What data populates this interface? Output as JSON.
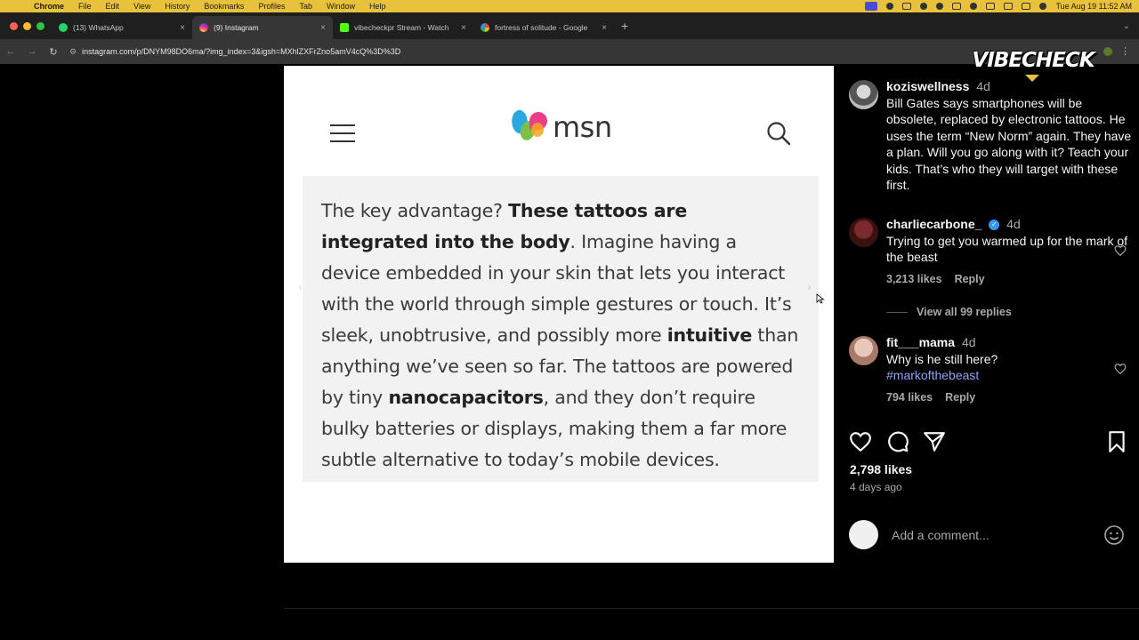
{
  "menubar": {
    "app_name": "Chrome",
    "items": [
      "File",
      "Edit",
      "View",
      "History",
      "Bookmarks",
      "Profiles",
      "Tab",
      "Window",
      "Help"
    ],
    "clock": "Tue Aug 19  11:52 AM"
  },
  "tabs": [
    {
      "title": "(13) WhatsApp",
      "icon": "whatsapp-icon",
      "active": false
    },
    {
      "title": "(9) Instagram",
      "icon": "instagram-icon",
      "active": true
    },
    {
      "title": "vibecheckpr Stream - Watch",
      "icon": "kick-icon",
      "active": false
    },
    {
      "title": "fortress of solitude - Google",
      "icon": "google-icon",
      "active": false
    }
  ],
  "addressbar": {
    "url": "instagram.com/p/DNYM98DO6ma/?img_index=3&igsh=MXhlZXFrZno5amV4cQ%3D%3D"
  },
  "overlay": {
    "logo_text": "VIBECHECK"
  },
  "post": {
    "msn_logo_text": "msn",
    "article": {
      "segments": [
        {
          "text": "The key advantage? ",
          "bold": false
        },
        {
          "text": "These tattoos are integrated into the body",
          "bold": true
        },
        {
          "text": ". Imagine having a device embedded in your skin that lets you interact with the world through simple gestures or touch. It’s sleek, unobtrusive, and possibly more ",
          "bold": false
        },
        {
          "text": "intuitive",
          "bold": true
        },
        {
          "text": " than anything we’ve seen so far. The tattoos are powered by tiny ",
          "bold": false
        },
        {
          "text": "nanocapacitors",
          "bold": true
        },
        {
          "text": ", and they don’t require bulky batteries or displays, making them a far more subtle alternative to today’s mobile devices.",
          "bold": false
        }
      ]
    }
  },
  "comments": [
    {
      "username": "koziswellness",
      "time": "4d",
      "text": "Bill Gates says smartphones will be obsolete, replaced by electronic tattoos. He uses the term “New Norm” again. They have a plan. Will you go along with it? Teach your kids. That’s who they will target with these first."
    },
    {
      "username": "charliecarbone_",
      "verified": true,
      "time": "4d",
      "text": "Trying to get you warmed up for the mark of the beast",
      "likes": "3,213 likes",
      "reply": "Reply",
      "view_replies": "View all 99 replies"
    },
    {
      "username": "fit___mama",
      "time": "4d",
      "text": "Why is he still here?",
      "hashtag": "#markofthebeast",
      "likes": "794 likes",
      "reply": "Reply"
    }
  ],
  "post_footer": {
    "likes": "2,798 likes",
    "date": "4 days ago",
    "comment_placeholder": "Add a comment..."
  }
}
